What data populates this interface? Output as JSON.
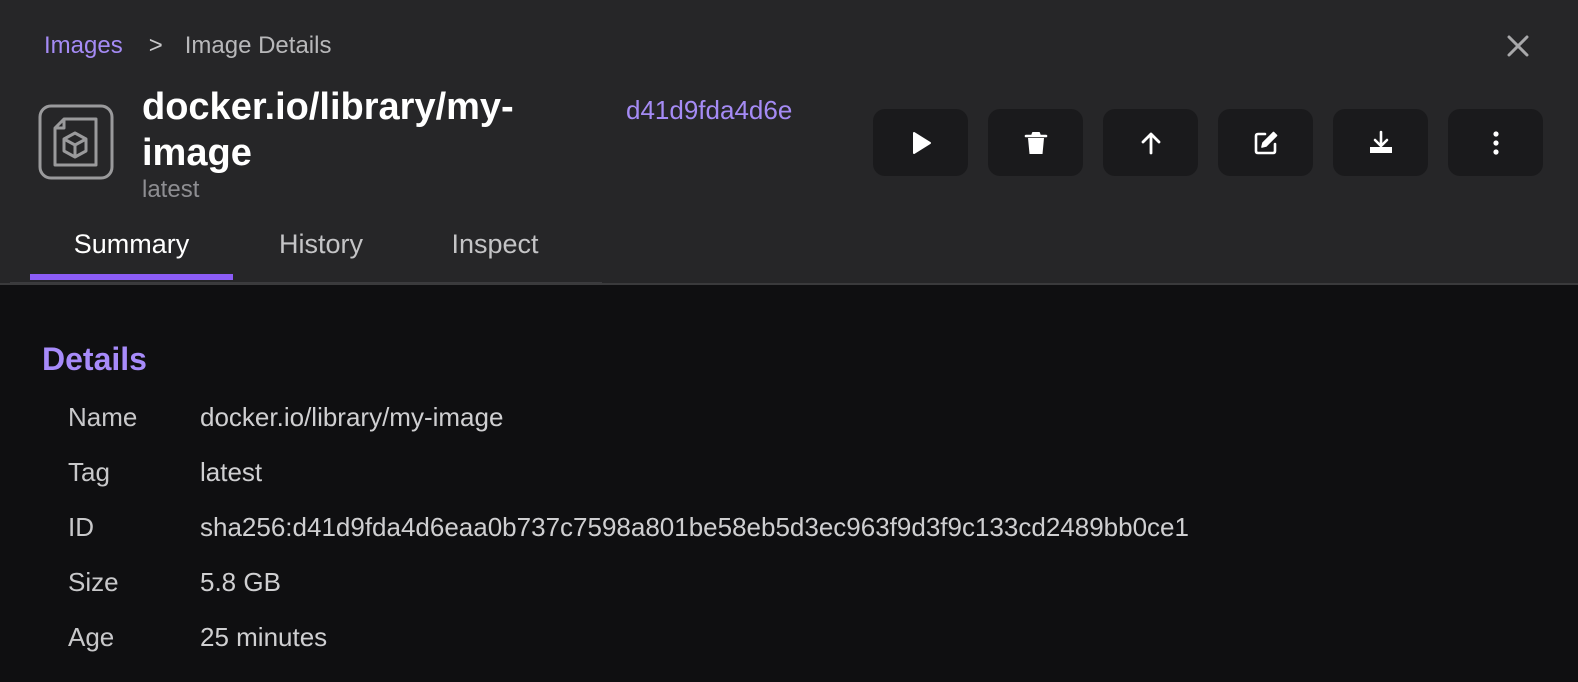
{
  "breadcrumb": {
    "parent": "Images",
    "separator": ">",
    "current": "Image Details"
  },
  "image": {
    "title": "docker.io/library/my-image",
    "tag": "latest",
    "short_id": "d41d9fda4d6e"
  },
  "actions": [
    {
      "icon": "play-icon"
    },
    {
      "icon": "trash-icon"
    },
    {
      "icon": "arrow-up-icon"
    },
    {
      "icon": "edit-icon"
    },
    {
      "icon": "download-icon"
    },
    {
      "icon": "more-vertical-icon"
    }
  ],
  "tabs": [
    {
      "label": "Summary",
      "active": true
    },
    {
      "label": "History",
      "active": false
    },
    {
      "label": "Inspect",
      "active": false
    }
  ],
  "details": {
    "heading": "Details",
    "rows": [
      {
        "label": "Name",
        "value": "docker.io/library/my-image"
      },
      {
        "label": "Tag",
        "value": "latest"
      },
      {
        "label": "ID",
        "value": "sha256:d41d9fda4d6eaa0b737c7598a801be58eb5d3ec963f9d3f9c133cd2489bb0ce1"
      },
      {
        "label": "Size",
        "value": "5.8 GB"
      },
      {
        "label": "Age",
        "value": "25 minutes"
      }
    ]
  },
  "colors": {
    "accent": "#a78bfa",
    "tab_indicator": "#8b5cf6",
    "header_bg": "#262628",
    "body_bg": "#0f0f11"
  }
}
